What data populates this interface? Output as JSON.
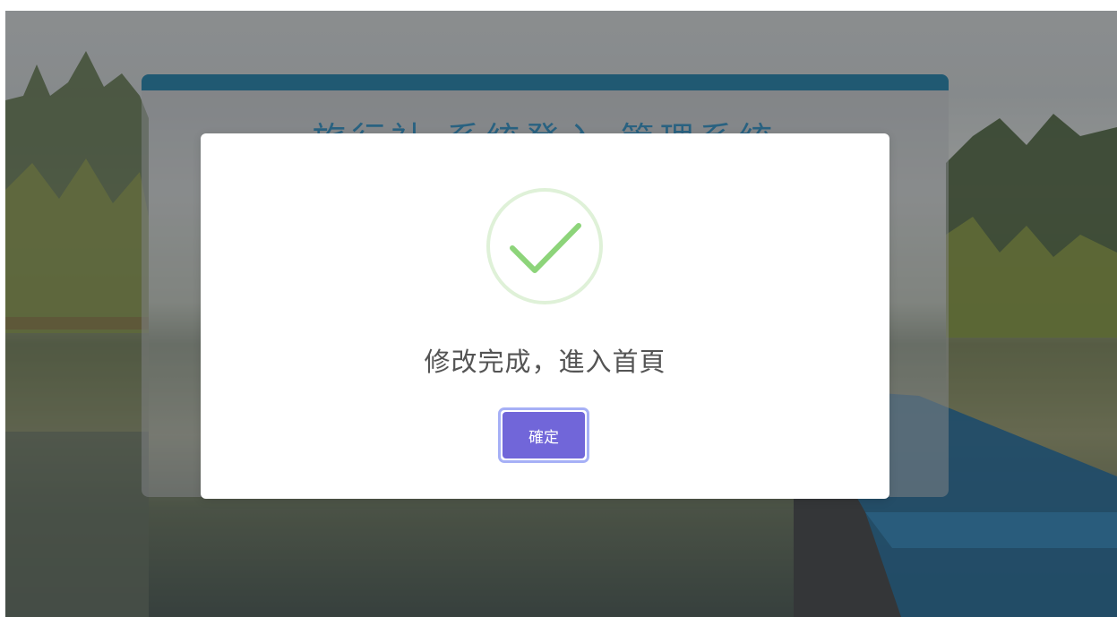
{
  "page": {
    "title": "旅行社 系統登入 管理系統"
  },
  "modal": {
    "icon": "success-check-icon",
    "message": "修改完成，進入首頁",
    "confirm_label": "確定"
  },
  "colors": {
    "page_card_bar": "#1d6f93",
    "page_card_title": "#2a7ca8",
    "success_green": "#8dd47a",
    "success_ring": "#dff1d8",
    "confirm_button": "#7166d9",
    "confirm_focus_ring": "#96a2f5",
    "message_text": "#545454"
  }
}
